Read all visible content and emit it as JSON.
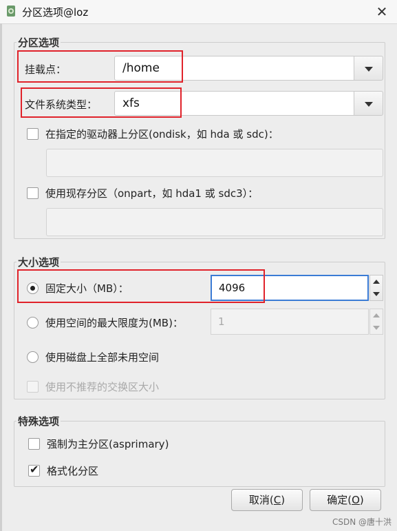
{
  "window": {
    "title": "分区选项@loz"
  },
  "partition_group": {
    "title": "分区选项",
    "mount_label": "挂载点：",
    "mount_value": "/home",
    "fs_label": "文件系统类型：",
    "fs_value": "xfs",
    "ondisk_label": "在指定的驱动器上分区(ondisk，如 hda 或 sdc)：",
    "ondisk_value": "",
    "onpart_label": "使用现存分区（onpart，如 hda1 或 sdc3）：",
    "onpart_value": ""
  },
  "size_group": {
    "title": "大小选项",
    "fixed_label": "固定大小（MB）：",
    "fixed_value": "4096",
    "max_label": "使用空间的最大限度为(MB)：",
    "max_value": "1",
    "fill_label": "使用磁盘上全部未用空间",
    "swap_label": "使用不推荐的交换区大小",
    "selected": "fixed"
  },
  "special_group": {
    "title": "特殊选项",
    "primary_label": "强制为主分区(asprimary)",
    "primary_checked": false,
    "format_label": "格式化分区",
    "format_checked": true
  },
  "buttons": {
    "cancel_text": "取消(",
    "cancel_key": "C",
    "ok_text": "确定(",
    "ok_key": "O",
    "close_paren": ")"
  },
  "watermark": "CSDN @唐十洪",
  "colors": {
    "highlight": "#e0222a",
    "focus": "#3a7bd5"
  }
}
